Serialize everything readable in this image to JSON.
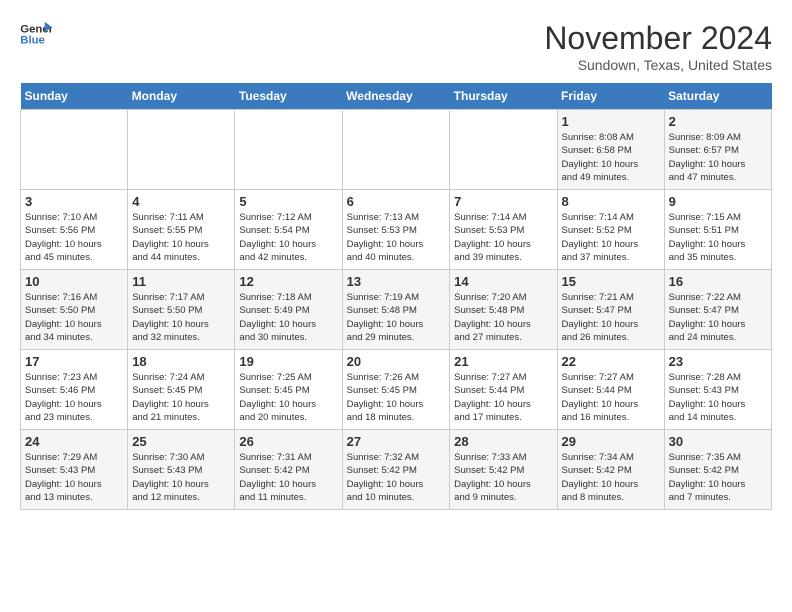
{
  "header": {
    "logo_line1": "General",
    "logo_line2": "Blue",
    "month": "November 2024",
    "location": "Sundown, Texas, United States"
  },
  "days_of_week": [
    "Sunday",
    "Monday",
    "Tuesday",
    "Wednesday",
    "Thursday",
    "Friday",
    "Saturday"
  ],
  "weeks": [
    [
      {
        "num": "",
        "info": ""
      },
      {
        "num": "",
        "info": ""
      },
      {
        "num": "",
        "info": ""
      },
      {
        "num": "",
        "info": ""
      },
      {
        "num": "",
        "info": ""
      },
      {
        "num": "1",
        "info": "Sunrise: 8:08 AM\nSunset: 6:58 PM\nDaylight: 10 hours\nand 49 minutes."
      },
      {
        "num": "2",
        "info": "Sunrise: 8:09 AM\nSunset: 6:57 PM\nDaylight: 10 hours\nand 47 minutes."
      }
    ],
    [
      {
        "num": "3",
        "info": "Sunrise: 7:10 AM\nSunset: 5:56 PM\nDaylight: 10 hours\nand 45 minutes."
      },
      {
        "num": "4",
        "info": "Sunrise: 7:11 AM\nSunset: 5:55 PM\nDaylight: 10 hours\nand 44 minutes."
      },
      {
        "num": "5",
        "info": "Sunrise: 7:12 AM\nSunset: 5:54 PM\nDaylight: 10 hours\nand 42 minutes."
      },
      {
        "num": "6",
        "info": "Sunrise: 7:13 AM\nSunset: 5:53 PM\nDaylight: 10 hours\nand 40 minutes."
      },
      {
        "num": "7",
        "info": "Sunrise: 7:14 AM\nSunset: 5:53 PM\nDaylight: 10 hours\nand 39 minutes."
      },
      {
        "num": "8",
        "info": "Sunrise: 7:14 AM\nSunset: 5:52 PM\nDaylight: 10 hours\nand 37 minutes."
      },
      {
        "num": "9",
        "info": "Sunrise: 7:15 AM\nSunset: 5:51 PM\nDaylight: 10 hours\nand 35 minutes."
      }
    ],
    [
      {
        "num": "10",
        "info": "Sunrise: 7:16 AM\nSunset: 5:50 PM\nDaylight: 10 hours\nand 34 minutes."
      },
      {
        "num": "11",
        "info": "Sunrise: 7:17 AM\nSunset: 5:50 PM\nDaylight: 10 hours\nand 32 minutes."
      },
      {
        "num": "12",
        "info": "Sunrise: 7:18 AM\nSunset: 5:49 PM\nDaylight: 10 hours\nand 30 minutes."
      },
      {
        "num": "13",
        "info": "Sunrise: 7:19 AM\nSunset: 5:48 PM\nDaylight: 10 hours\nand 29 minutes."
      },
      {
        "num": "14",
        "info": "Sunrise: 7:20 AM\nSunset: 5:48 PM\nDaylight: 10 hours\nand 27 minutes."
      },
      {
        "num": "15",
        "info": "Sunrise: 7:21 AM\nSunset: 5:47 PM\nDaylight: 10 hours\nand 26 minutes."
      },
      {
        "num": "16",
        "info": "Sunrise: 7:22 AM\nSunset: 5:47 PM\nDaylight: 10 hours\nand 24 minutes."
      }
    ],
    [
      {
        "num": "17",
        "info": "Sunrise: 7:23 AM\nSunset: 5:46 PM\nDaylight: 10 hours\nand 23 minutes."
      },
      {
        "num": "18",
        "info": "Sunrise: 7:24 AM\nSunset: 5:45 PM\nDaylight: 10 hours\nand 21 minutes."
      },
      {
        "num": "19",
        "info": "Sunrise: 7:25 AM\nSunset: 5:45 PM\nDaylight: 10 hours\nand 20 minutes."
      },
      {
        "num": "20",
        "info": "Sunrise: 7:26 AM\nSunset: 5:45 PM\nDaylight: 10 hours\nand 18 minutes."
      },
      {
        "num": "21",
        "info": "Sunrise: 7:27 AM\nSunset: 5:44 PM\nDaylight: 10 hours\nand 17 minutes."
      },
      {
        "num": "22",
        "info": "Sunrise: 7:27 AM\nSunset: 5:44 PM\nDaylight: 10 hours\nand 16 minutes."
      },
      {
        "num": "23",
        "info": "Sunrise: 7:28 AM\nSunset: 5:43 PM\nDaylight: 10 hours\nand 14 minutes."
      }
    ],
    [
      {
        "num": "24",
        "info": "Sunrise: 7:29 AM\nSunset: 5:43 PM\nDaylight: 10 hours\nand 13 minutes."
      },
      {
        "num": "25",
        "info": "Sunrise: 7:30 AM\nSunset: 5:43 PM\nDaylight: 10 hours\nand 12 minutes."
      },
      {
        "num": "26",
        "info": "Sunrise: 7:31 AM\nSunset: 5:42 PM\nDaylight: 10 hours\nand 11 minutes."
      },
      {
        "num": "27",
        "info": "Sunrise: 7:32 AM\nSunset: 5:42 PM\nDaylight: 10 hours\nand 10 minutes."
      },
      {
        "num": "28",
        "info": "Sunrise: 7:33 AM\nSunset: 5:42 PM\nDaylight: 10 hours\nand 9 minutes."
      },
      {
        "num": "29",
        "info": "Sunrise: 7:34 AM\nSunset: 5:42 PM\nDaylight: 10 hours\nand 8 minutes."
      },
      {
        "num": "30",
        "info": "Sunrise: 7:35 AM\nSunset: 5:42 PM\nDaylight: 10 hours\nand 7 minutes."
      }
    ]
  ]
}
